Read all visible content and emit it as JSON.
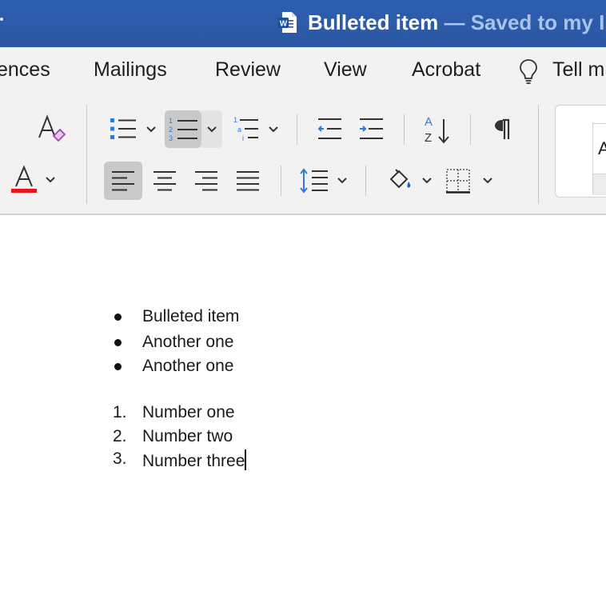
{
  "titlebar": {
    "doc_name": "Bulleted item",
    "save_status": " — Saved to my I",
    "app_icon": "word-icon"
  },
  "tabs": [
    {
      "label": "ences"
    },
    {
      "label": "Mailings"
    },
    {
      "label": "Review"
    },
    {
      "label": "View"
    },
    {
      "label": "Acrobat"
    },
    {
      "label": "Tell m"
    }
  ],
  "ribbon": {
    "font_color_swatch": "#e8161b",
    "styles_preview_label": "A",
    "buttons": [
      {
        "name": "clear-formatting",
        "icon": "clear-formatting-icon"
      },
      {
        "name": "font-color",
        "icon": "font-color-icon"
      },
      {
        "name": "bullets",
        "icon": "bullet-list-icon"
      },
      {
        "name": "numbering",
        "icon": "numbered-list-icon",
        "active": true
      },
      {
        "name": "multilevel",
        "icon": "multilevel-list-icon"
      },
      {
        "name": "decrease-indent",
        "icon": "decrease-indent-icon"
      },
      {
        "name": "increase-indent",
        "icon": "increase-indent-icon"
      },
      {
        "name": "sort",
        "icon": "sort-icon"
      },
      {
        "name": "show-formatting",
        "icon": "pilcrow-icon"
      },
      {
        "name": "align-left",
        "icon": "align-left-icon",
        "active": true
      },
      {
        "name": "align-center",
        "icon": "align-center-icon"
      },
      {
        "name": "align-right",
        "icon": "align-right-icon"
      },
      {
        "name": "justify",
        "icon": "justify-icon"
      },
      {
        "name": "line-spacing",
        "icon": "line-spacing-icon"
      },
      {
        "name": "shading",
        "icon": "paint-bucket-icon"
      },
      {
        "name": "borders",
        "icon": "borders-icon"
      }
    ]
  },
  "document": {
    "bulleted": [
      "Bulleted item",
      "Another one",
      "Another one"
    ],
    "numbered": [
      {
        "marker": "1.",
        "text": "Number one"
      },
      {
        "marker": "2.",
        "text": "Number two"
      },
      {
        "marker": "3.",
        "text": "Number three"
      }
    ]
  }
}
